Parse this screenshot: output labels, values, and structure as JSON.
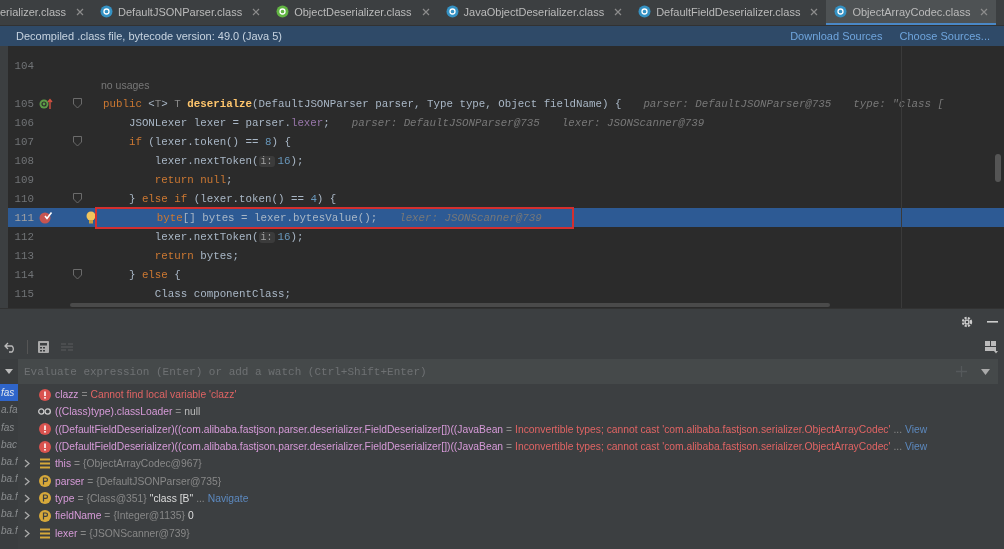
{
  "tabs": [
    {
      "label": "erializer.class",
      "selected": false
    },
    {
      "label": "DefaultJSONParser.class",
      "kind": "class",
      "selected": false
    },
    {
      "label": "ObjectDeserializer.class",
      "kind": "interface",
      "selected": false
    },
    {
      "label": "JavaObjectDeserializer.class",
      "kind": "class",
      "selected": false
    },
    {
      "label": "DefaultFieldDeserializer.class",
      "kind": "class",
      "selected": false
    },
    {
      "label": "ObjectArrayCodec.class",
      "kind": "class",
      "selected": true
    }
  ],
  "banner": {
    "text": "Decompiled .class file, bytecode version: 49.0 (Java 5)",
    "links": [
      "Download Sources",
      "Choose Sources..."
    ]
  },
  "editor": {
    "lines": [
      {
        "number": "104",
        "fold": false,
        "selected": false
      },
      {
        "kind": "inlay",
        "text": "no usages"
      },
      {
        "number": "105",
        "implemented": true,
        "fold": true,
        "selected": false,
        "tokens": [
          {
            "kind": "keyword",
            "text": "public "
          },
          {
            "kind": "plain",
            "text": "<"
          },
          {
            "kind": "type-param",
            "text": "T"
          },
          {
            "kind": "plain",
            "text": "> "
          },
          {
            "kind": "type-param",
            "text": "T "
          },
          {
            "kind": "method",
            "text": "deserialze"
          },
          {
            "kind": "plain",
            "text": "(DefaultJSONParser parser, Type type, Object fieldName) {"
          },
          {
            "kind": "hint",
            "text": "parser: DefaultJSONParser@735"
          },
          {
            "kind": "hint",
            "text": "type: \"class ["
          }
        ]
      },
      {
        "number": "106",
        "fold": false,
        "selected": false,
        "tokens": [
          {
            "kind": "plain",
            "text": "    JSONLexer lexer = parser."
          },
          {
            "kind": "field",
            "text": "lexer"
          },
          {
            "kind": "plain",
            "text": ";"
          },
          {
            "kind": "hint",
            "text": "parser: DefaultJSONParser@735"
          },
          {
            "kind": "hint",
            "text": "lexer: JSONScanner@739"
          }
        ]
      },
      {
        "number": "107",
        "fold": true,
        "selected": false,
        "tokens": [
          {
            "kind": "keyword",
            "text": "    if "
          },
          {
            "kind": "plain",
            "text": "(lexer.token() == "
          },
          {
            "kind": "number",
            "text": "8"
          },
          {
            "kind": "plain",
            "text": ") {"
          }
        ]
      },
      {
        "number": "108",
        "fold": false,
        "selected": false,
        "tokens": [
          {
            "kind": "plain",
            "text": "        lexer.nextToken("
          },
          {
            "kind": "param-hint",
            "text": "i:"
          },
          {
            "kind": "number",
            "text": "16"
          },
          {
            "kind": "plain",
            "text": ");"
          }
        ]
      },
      {
        "number": "109",
        "fold": false,
        "selected": false,
        "tokens": [
          {
            "kind": "keyword",
            "text": "        return null"
          },
          {
            "kind": "plain",
            "text": ";"
          }
        ]
      },
      {
        "number": "110",
        "fold": true,
        "selected": false,
        "tokens": [
          {
            "kind": "plain",
            "text": "    } "
          },
          {
            "kind": "keyword",
            "text": "else if "
          },
          {
            "kind": "plain",
            "text": "(lexer.token() == "
          },
          {
            "kind": "number",
            "text": "4"
          },
          {
            "kind": "plain",
            "text": ") {"
          }
        ]
      },
      {
        "number": "111",
        "breakpoint": true,
        "intention": true,
        "boxed": true,
        "fold": false,
        "selected": true,
        "tokens": [
          {
            "kind": "keyword",
            "text": "        byte"
          },
          {
            "kind": "plain",
            "text": "[] bytes = lexer.bytesValue();"
          },
          {
            "kind": "hint",
            "text": "lexer: JSONScanner@739"
          }
        ]
      },
      {
        "number": "112",
        "fold": false,
        "selected": false,
        "tokens": [
          {
            "kind": "plain",
            "text": "        lexer.nextToken("
          },
          {
            "kind": "param-hint",
            "text": "i:"
          },
          {
            "kind": "number",
            "text": "16"
          },
          {
            "kind": "plain",
            "text": ");"
          }
        ]
      },
      {
        "number": "113",
        "fold": false,
        "selected": false,
        "tokens": [
          {
            "kind": "keyword",
            "text": "        return "
          },
          {
            "kind": "plain",
            "text": "bytes;"
          }
        ]
      },
      {
        "number": "114",
        "fold": true,
        "selected": false,
        "tokens": [
          {
            "kind": "plain",
            "text": "    } "
          },
          {
            "kind": "keyword",
            "text": "else "
          },
          {
            "kind": "plain",
            "text": "{"
          }
        ]
      },
      {
        "number": "115",
        "fold": false,
        "selected": false,
        "tokens": [
          {
            "kind": "plain",
            "text": "        Class componentClass;"
          }
        ]
      }
    ]
  },
  "debugger": {
    "frames": [
      {
        "text": "fas",
        "selected": true
      },
      {
        "text": "a.fa",
        "selected": false
      },
      {
        "text": "fas",
        "selected": false
      },
      {
        "text": "bac",
        "selected": false
      },
      {
        "text": "ba.f",
        "selected": false
      },
      {
        "text": "ba.f",
        "selected": false
      },
      {
        "text": "ba.f",
        "selected": false
      },
      {
        "text": "ba.f",
        "selected": false
      },
      {
        "text": "ba.f",
        "selected": false
      }
    ],
    "evaluate": {
      "placeholder": "Evaluate expression (Enter) or add a watch (Ctrl+Shift+Enter)"
    },
    "variables": [
      {
        "kind": "error",
        "name": "clazz",
        "separator": "=",
        "value": "Cannot find local variable 'clazz'"
      },
      {
        "kind": "watch",
        "name": "((Class)type).classLoader",
        "separator": "=",
        "value": "null"
      },
      {
        "kind": "error",
        "name": "((DefaultFieldDeserializer)((com.alibaba.fastjson.parser.deserializer.FieldDeserializer[])((JavaBean",
        "separator": "=",
        "value": "Inconvertible types; cannot cast 'com.alibaba.fastjson.serializer.ObjectArrayCodec'",
        "more": "...",
        "link": "View"
      },
      {
        "kind": "error",
        "name": "((DefaultFieldDeserializer)((com.alibaba.fastjson.parser.deserializer.FieldDeserializer[])((JavaBean",
        "separator": "=",
        "value": "Inconvertible types; cannot cast 'com.alibaba.fastjson.serializer.ObjectArrayCodec'",
        "more": "...",
        "link": "View"
      },
      {
        "kind": "field",
        "name": "this",
        "separator": "=",
        "ref": "{ObjectArrayCodec@967}"
      },
      {
        "kind": "param",
        "name": "parser",
        "separator": "=",
        "ref": "{DefaultJSONParser@735}"
      },
      {
        "kind": "param",
        "name": "type",
        "separator": "=",
        "ref": "{Class@351}",
        "value": "\"class [B\"",
        "more": "...",
        "link": "Navigate"
      },
      {
        "kind": "param",
        "name": "fieldName",
        "separator": "=",
        "ref": "{Integer@1135}",
        "value": "0"
      },
      {
        "kind": "field",
        "name": "lexer",
        "separator": "=",
        "ref": "{JSONScanner@739}"
      }
    ]
  }
}
